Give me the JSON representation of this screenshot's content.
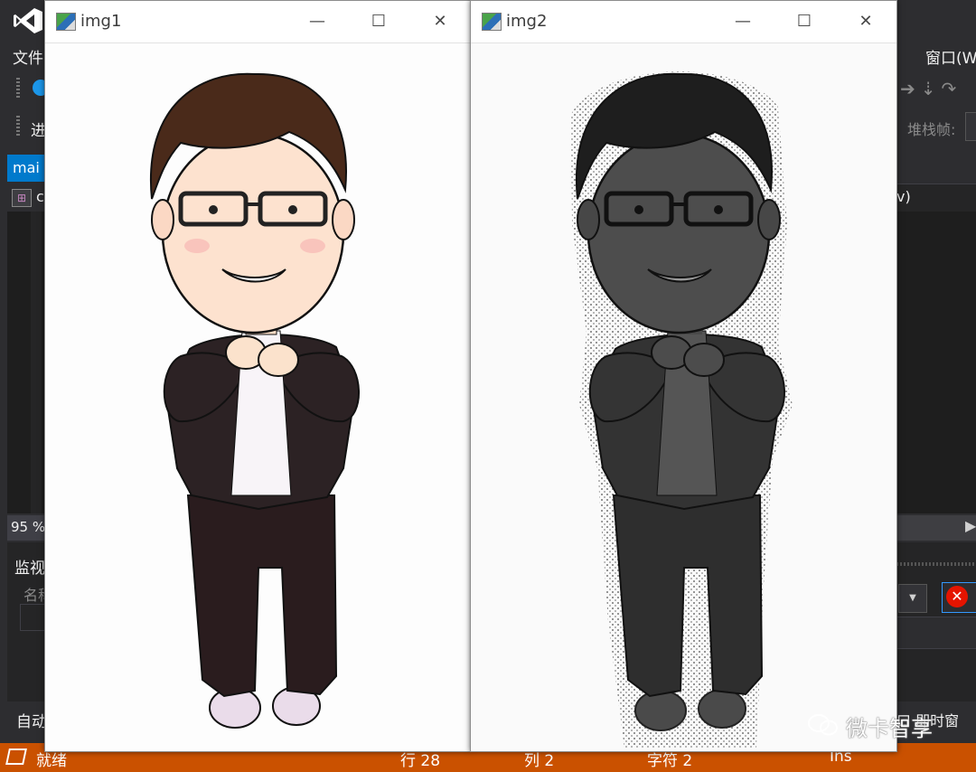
{
  "ide": {
    "menu_file": "文件",
    "menu_paren": ")",
    "menu_window": "窗口(W",
    "process_label": "进",
    "stack_frame_label": "堆栈帧:",
    "doc_tab": "mai",
    "nav_scope": "c",
    "nav_right": "v)",
    "zoom": "95 %",
    "watch_title": "监视",
    "watch_name_col": "名称",
    "auto_tab": "自动",
    "bottom_right_tabs": "口  即时窗"
  },
  "status": {
    "ready": "就绪",
    "line": "行 28",
    "col": "列 2",
    "char": "字符 2",
    "ins": "Ins"
  },
  "windows": [
    {
      "title": "img1",
      "minimize": "—",
      "maximize": "☐",
      "close": "✕"
    },
    {
      "title": "img2",
      "minimize": "—",
      "maximize": "☐",
      "close": "✕"
    }
  ],
  "watermark": {
    "text": "微卡智享"
  },
  "colors": {
    "status_bar": "#ca5100",
    "ide_bg": "#2d2d30",
    "accent": "#007acc",
    "error": "#e51400"
  }
}
